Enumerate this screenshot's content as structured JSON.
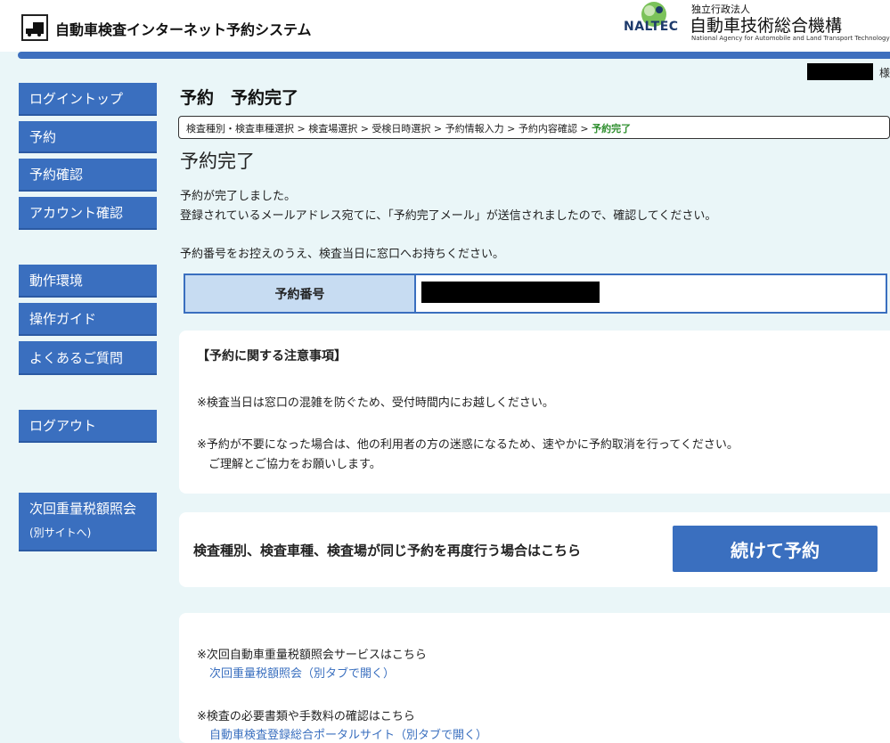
{
  "header": {
    "site_title": "自動車検査インターネット予約システム",
    "org_sub": "独立行政法人",
    "org_name": "自動車技術総合機構",
    "org_en": "National Agency for Automobile and Land Transport Technology",
    "naltec": "NALTEC"
  },
  "user": {
    "suffix": "様"
  },
  "sidebar": {
    "items": [
      {
        "label": "ログイントップ"
      },
      {
        "label": "予約"
      },
      {
        "label": "予約確認"
      },
      {
        "label": "アカウント確認"
      },
      {
        "label": "動作環境"
      },
      {
        "label": "操作ガイド"
      },
      {
        "label": "よくあるご質問"
      },
      {
        "label": "ログアウト"
      },
      {
        "label": "次回重量税額照会",
        "sub": "(別サイトへ)"
      }
    ]
  },
  "main": {
    "page_title": "予約　予約完了",
    "breadcrumb": {
      "steps": [
        "検査種別・検査車種選択",
        "検査場選択",
        "受検日時選択",
        "予約情報入力",
        "予約内容確認"
      ],
      "separator": " > ",
      "current": "予約完了"
    },
    "sub_title": "予約完了",
    "messages": [
      "予約が完了しました。",
      "登録されているメールアドレス宛てに、「予約完了メール」が送信されましたので、確認してください。",
      "予約番号をお控えのうえ、検査当日に窓口へお持ちください。"
    ],
    "reservation_label": "予約番号",
    "notice": {
      "title": "【予約に関する注意事項】",
      "lines": [
        "※検査当日は窓口の混雑を防ぐため、受付時間内にお越しください。",
        "※予約が不要になった場合は、他の利用者の方の迷惑になるため、速やかに予約取消を行ってください。",
        "　ご理解とご協力をお願いします。"
      ]
    },
    "continue": {
      "text": "検査種別、検査車種、検査場が同じ予約を再度行う場合はこちら",
      "button": "続けて予約"
    },
    "links": {
      "tax_text": "※次回自動車重量税額照会サービスはこちら",
      "tax_link": "次回重量税額照会（別タブで開く）",
      "docs_text": "※検査の必要書類や手数料の確認はこちら",
      "docs_link": "自動車検査登録総合ポータルサイト（別タブで開く）"
    }
  },
  "colors": {
    "accent": "#3a6fbf",
    "background": "#eaf6f8",
    "current_step": "#2f8f2f"
  }
}
